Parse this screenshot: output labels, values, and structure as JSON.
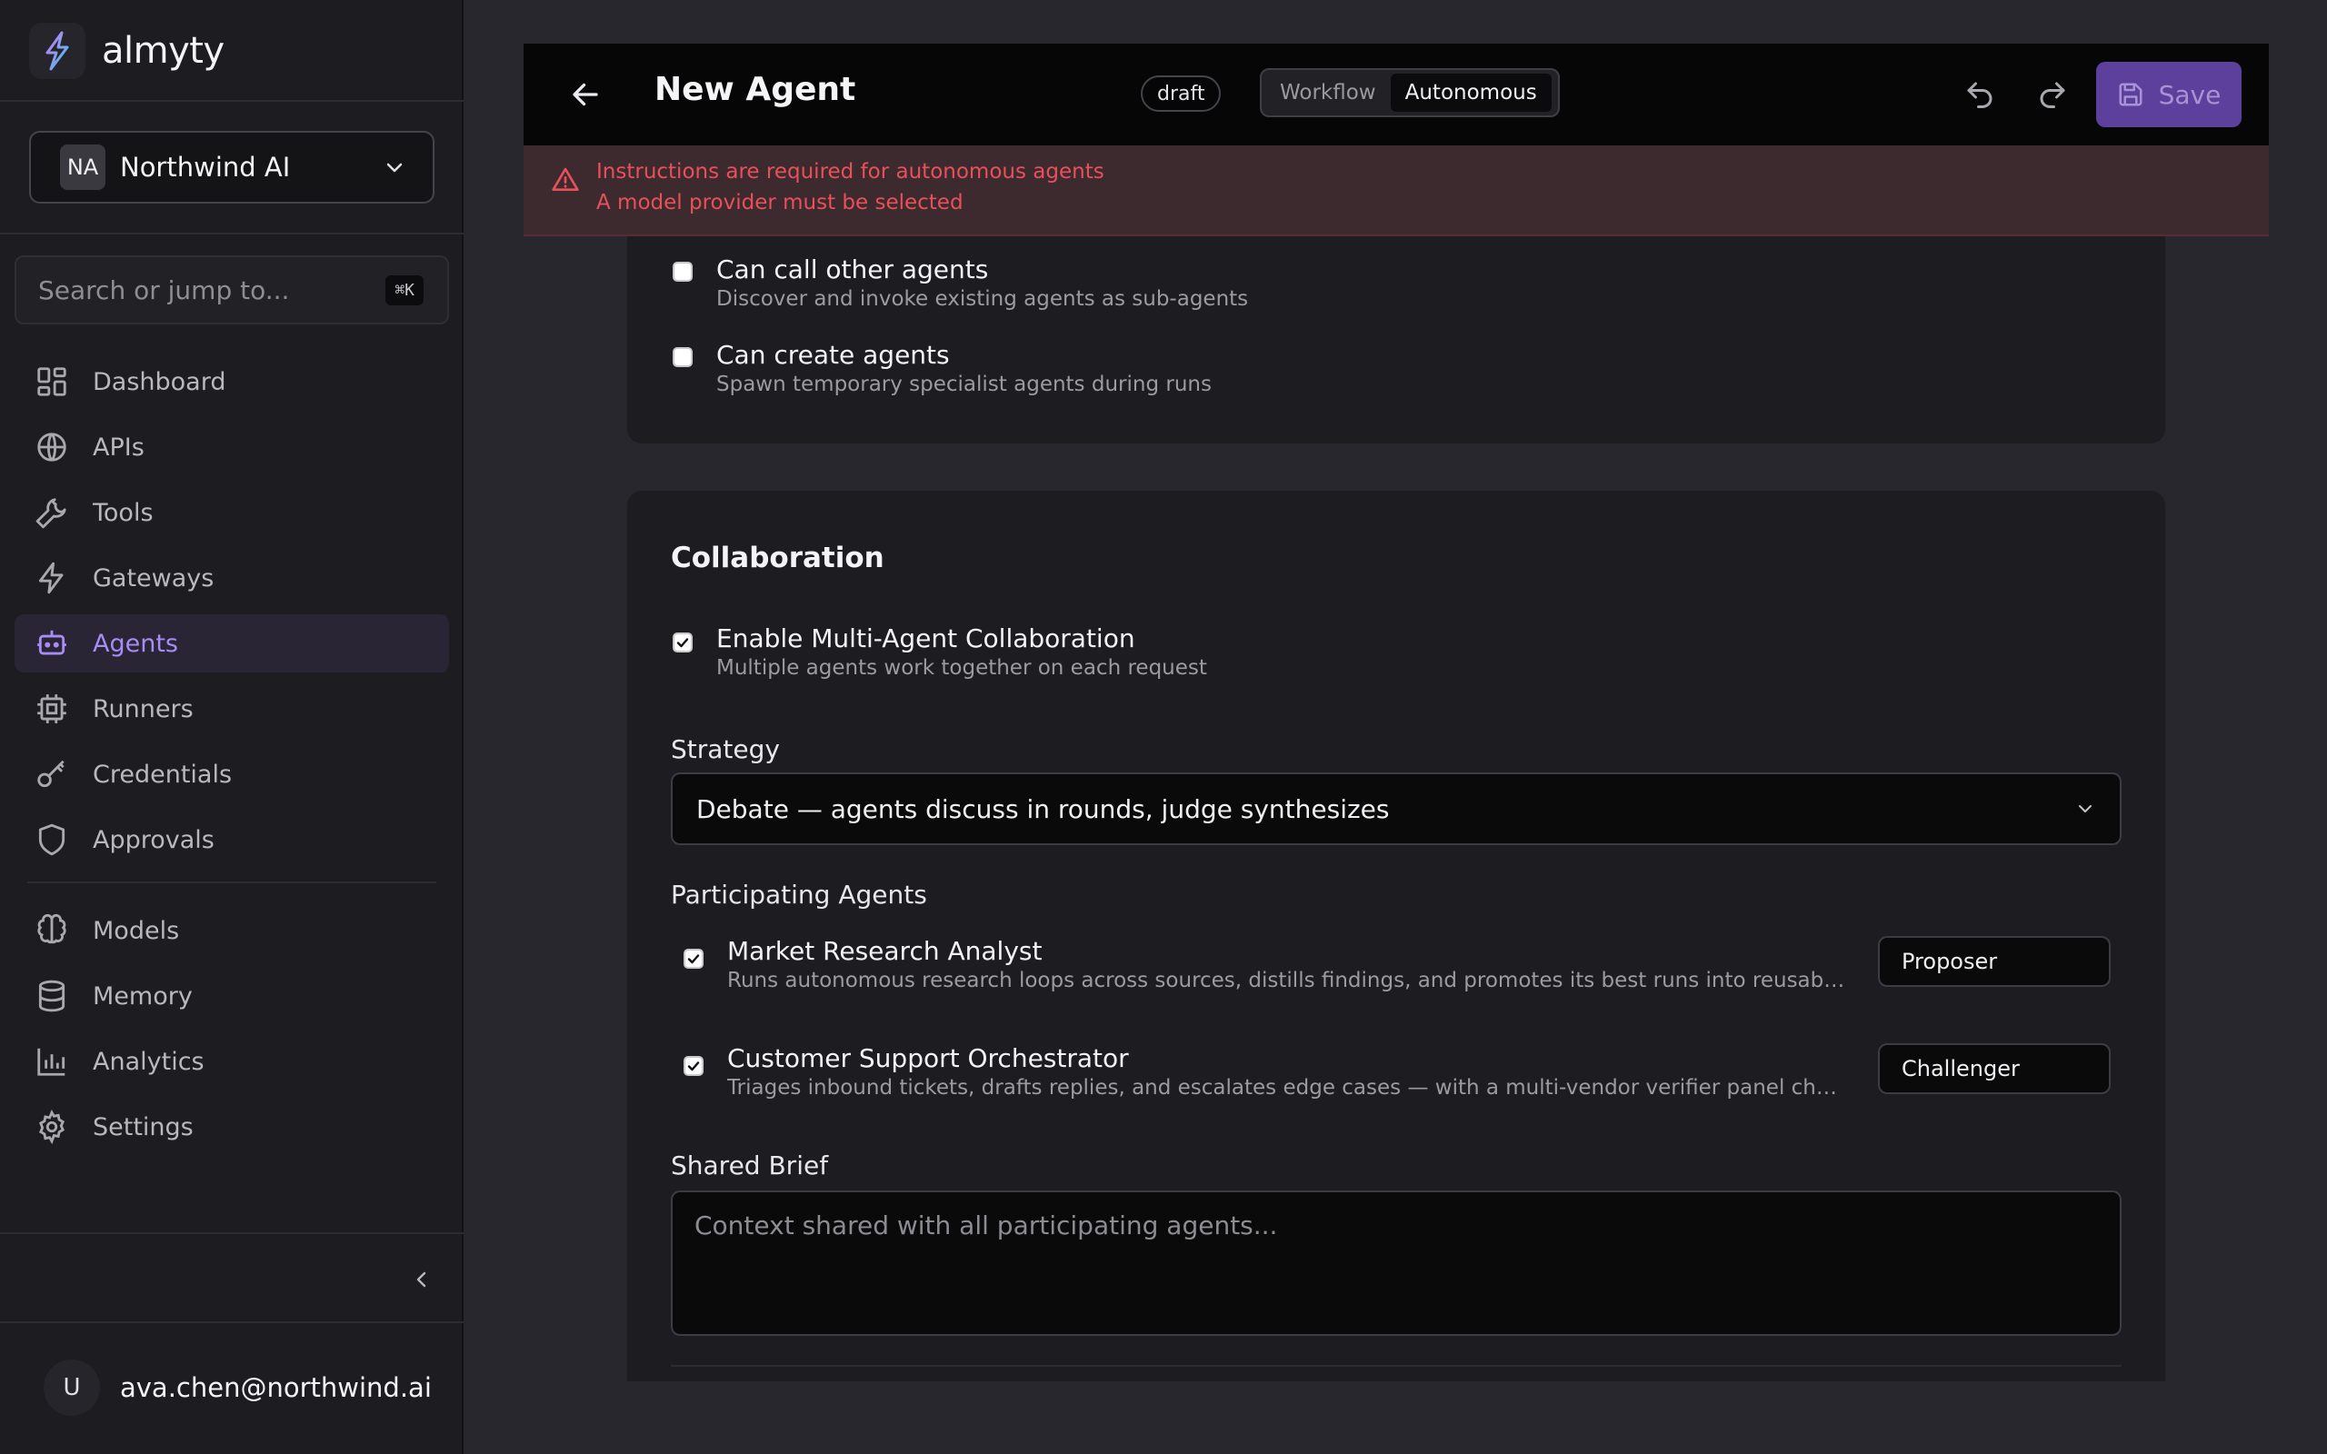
{
  "app": {
    "name": "almyty",
    "org_initials": "NA",
    "org_name": "Northwind AI",
    "search_placeholder": "Search or jump to...",
    "search_shortcut": "⌘K",
    "user_initial": "U",
    "user_email": "ava.chen@northwind.ai",
    "accent_color": "#a98bf6"
  },
  "nav": {
    "items": [
      {
        "label": "Dashboard",
        "icon": "dashboard-icon"
      },
      {
        "label": "APIs",
        "icon": "globe-icon"
      },
      {
        "label": "Tools",
        "icon": "wrench-icon"
      },
      {
        "label": "Gateways",
        "icon": "lightning-icon"
      },
      {
        "label": "Agents",
        "icon": "robot-icon",
        "active": true
      },
      {
        "label": "Runners",
        "icon": "chip-icon"
      },
      {
        "label": "Credentials",
        "icon": "key-icon"
      },
      {
        "label": "Approvals",
        "icon": "shield-icon"
      }
    ],
    "items2": [
      {
        "label": "Models",
        "icon": "brain-icon"
      },
      {
        "label": "Memory",
        "icon": "database-icon"
      },
      {
        "label": "Analytics",
        "icon": "bar-chart-icon"
      },
      {
        "label": "Settings",
        "icon": "gear-icon"
      }
    ]
  },
  "header": {
    "title": "New Agent",
    "status_badge": "draft",
    "mode_options": [
      "Workflow",
      "Autonomous"
    ],
    "mode_selected": "Autonomous",
    "save_label": "Save"
  },
  "errors": [
    "Instructions are required for autonomous agents",
    "A model provider must be selected"
  ],
  "capabilities": [
    {
      "title": "Can call other agents",
      "desc": "Discover and invoke existing agents as sub-agents",
      "checked": false
    },
    {
      "title": "Can create agents",
      "desc": "Spawn temporary specialist agents during runs",
      "checked": false
    }
  ],
  "collaboration": {
    "title": "Collaboration",
    "enable_title": "Enable Multi-Agent Collaboration",
    "enable_desc": "Multiple agents work together on each request",
    "enabled": true,
    "strategy_label": "Strategy",
    "strategy_value": "Debate — agents discuss in rounds, judge synthesizes",
    "participants_label": "Participating Agents",
    "participants": [
      {
        "name": "Market Research Analyst",
        "desc": "Runs autonomous research loops across sources, distills findings, and promotes its best runs into reusable skills",
        "role": "Proposer",
        "checked": true
      },
      {
        "name": "Customer Support Orchestrator",
        "desc": "Triages inbound tickets, drafts replies, and escalates edge cases — with a multi-vendor verifier panel checking responses",
        "role": "Challenger",
        "checked": true
      }
    ],
    "brief_label": "Shared Brief",
    "brief_placeholder": "Context shared with all participating agents..."
  }
}
